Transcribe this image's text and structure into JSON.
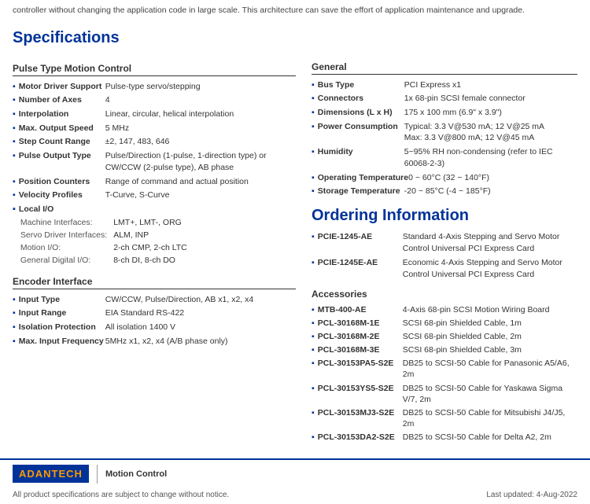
{
  "banner": {
    "text": "controller without changing the application code in large scale. This architecture can save the effort of application maintenance and upgrade."
  },
  "page_title": "Specifications",
  "left_column": {
    "pulse_type_section": {
      "title": "Pulse Type Motion Control",
      "items": [
        {
          "key": "Motor Driver Support",
          "value": "Pulse-type servo/stepping"
        },
        {
          "key": "Number of Axes",
          "value": "4"
        },
        {
          "key": "Interpolation",
          "value": "Linear, circular, helical interpolation"
        },
        {
          "key": "Max. Output Speed",
          "value": "5 MHz"
        },
        {
          "key": "Step Count Range",
          "value": "±2, 147, 483, 646"
        },
        {
          "key": "Pulse Output Type",
          "value": "Pulse/Direction (1-pulse, 1-direction type) or CW/CCW (2-pulse type), AB phase"
        },
        {
          "key": "Position Counters",
          "value": "Range of command and actual position"
        },
        {
          "key": "Velocity Profiles",
          "value": "T-Curve, S-Curve"
        }
      ],
      "local_io": {
        "key": "Local I/O",
        "sub_items": [
          {
            "label": "Machine Interfaces:",
            "value": "LMT+, LMT-, ORG"
          },
          {
            "label": "Servo Driver Interfaces:",
            "value": "ALM, INP"
          },
          {
            "label": "Motion I/O:",
            "value": "2-ch CMP, 2-ch LTC"
          },
          {
            "label": "General Digital I/O:",
            "value": "8-ch DI, 8-ch DO"
          }
        ]
      }
    },
    "encoder_section": {
      "title": "Encoder Interface",
      "items": [
        {
          "key": "Input Type",
          "value": "CW/CCW, Pulse/Direction, AB x1, x2, x4"
        },
        {
          "key": "Input Range",
          "value": "EIA Standard RS-422"
        },
        {
          "key": "Isolation Protection",
          "value": "All isolation 1400 V"
        },
        {
          "key": "Max. Input Frequency",
          "value": "5MHz x1, x2, x4 (A/B phase only)"
        }
      ]
    }
  },
  "right_column": {
    "general_section": {
      "title": "General",
      "items": [
        {
          "key": "Bus Type",
          "value": "PCI Express x1"
        },
        {
          "key": "Connectors",
          "value": "1x 68-pin SCSI female connector"
        },
        {
          "key": "Dimensions (L x H)",
          "value": "175 x 100 mm (6.9\" x 3.9\")"
        },
        {
          "key": "Power Consumption",
          "value": "Typical: 3.3 V@530 mA; 12 V@25 mA\nMax: 3.3 V@800 mA; 12 V@45 mA"
        },
        {
          "key": "Humidity",
          "value": "5~95% RH non-condensing (refer to IEC 60068-2-3)"
        },
        {
          "key": "Operating Temperature",
          "value": "0 ~ 60°C (32 ~ 140°F)"
        },
        {
          "key": "Storage Temperature",
          "value": "-20 ~ 85°C (-4 ~ 185°F)"
        }
      ]
    },
    "ordering_section": {
      "title": "Ordering Information",
      "items": [
        {
          "key": "PCIE-1245-AE",
          "value": "Standard 4-Axis Stepping and Servo Motor Control Universal PCI Express Card"
        },
        {
          "key": "PCIE-1245E-AE",
          "value": "Economic 4-Axis Stepping and Servo Motor Control Universal PCI Express Card"
        }
      ]
    },
    "accessories_section": {
      "title": "Accessories",
      "items": [
        {
          "key": "MTB-400-AE",
          "value": "4-Axis 68-pin SCSI Motion Wiring Board"
        },
        {
          "key": "PCL-30168M-1E",
          "value": "SCSI 68-pin Shielded Cable, 1m"
        },
        {
          "key": "PCL-30168M-2E",
          "value": "SCSI 68-pin Shielded Cable, 2m"
        },
        {
          "key": "PCL-30168M-3E",
          "value": "SCSI 68-pin Shielded Cable, 3m"
        },
        {
          "key": "PCL-30153PA5-S2E",
          "value": "DB25 to SCSI-50 Cable for Panasonic A5/A6, 2m"
        },
        {
          "key": "PCL-30153YS5-S2E",
          "value": "DB25 to SCSI-50 Cable for Yaskawa Sigma V/7, 2m"
        },
        {
          "key": "PCL-30153MJ3-S2E",
          "value": "DB25 to SCSI-50 Cable for Mitsubishi J4/J5, 2m"
        },
        {
          "key": "PCL-30153DA2-S2E",
          "value": "DB25 to SCSI-50 Cable for Delta A2, 2m"
        }
      ]
    }
  },
  "footer": {
    "logo_text": "AD",
    "logo_highlight": "ANTECH",
    "section_label": "Motion Control",
    "note_left": "All product specifications are subject to change without notice.",
    "note_right": "Last updated: 4-Aug-2022"
  }
}
